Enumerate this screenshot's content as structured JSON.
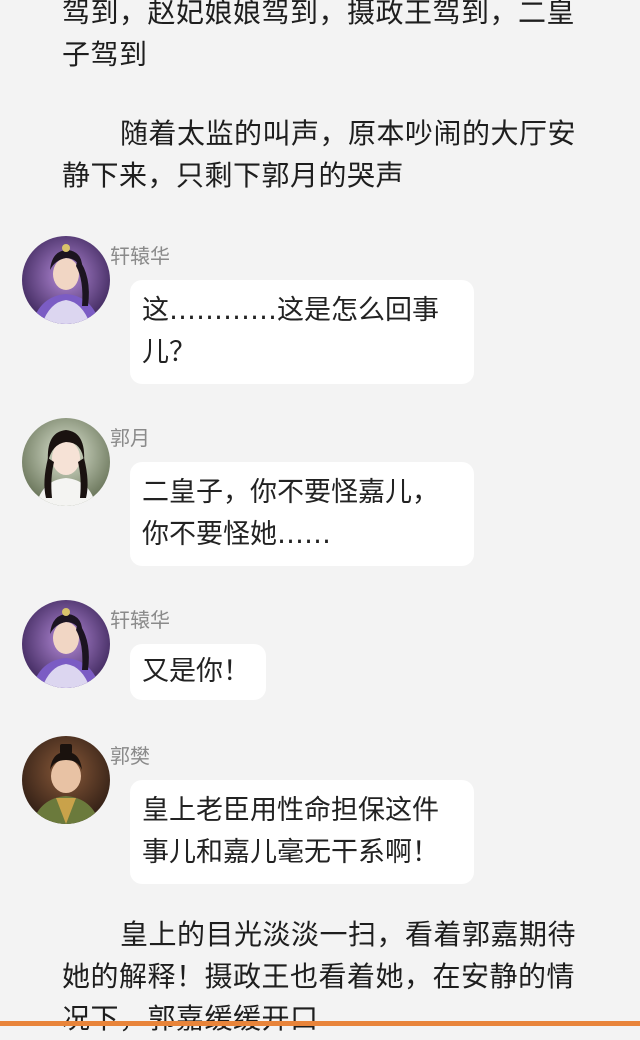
{
  "narration": [
    {
      "lines": [
        "驾到，赵妃娘娘驾到，摄政王驾到，二皇",
        "子驾到"
      ]
    },
    {
      "lines": [
        "随着太监的叫声，原本吵闹的大厅安",
        "静下来，只剩下郭月的哭声"
      ]
    },
    {
      "lines": [
        "皇上的目光淡淡一扫，看着郭嘉期待",
        "她的解释！摄政王也看着她，在安静的情",
        "况下，郭嘉缓缓开口"
      ]
    }
  ],
  "messages": [
    {
      "sender": "轩辕华",
      "lines": [
        "这…………这是怎么回事",
        "儿？"
      ]
    },
    {
      "sender": "郭月",
      "lines": [
        "二皇子，你不要怪嘉儿，",
        "你不要怪她……"
      ]
    },
    {
      "sender": "轩辕华",
      "lines": [
        "又是你！"
      ]
    },
    {
      "sender": "郭樊",
      "lines": [
        "皇上老臣用性命担保这件",
        "事儿和嘉儿毫无干系啊！"
      ]
    }
  ],
  "colors": {
    "background": "#f3f3f3",
    "bubble": "#ffffff",
    "sender": "#8a8a8a",
    "accent_bar": "#e8843a"
  },
  "icons": {
    "avatar_xuanyuanhua": "avatar-costume-male-purple",
    "avatar_guoyue": "avatar-costume-female-white",
    "avatar_guofan": "avatar-costume-male-official"
  }
}
